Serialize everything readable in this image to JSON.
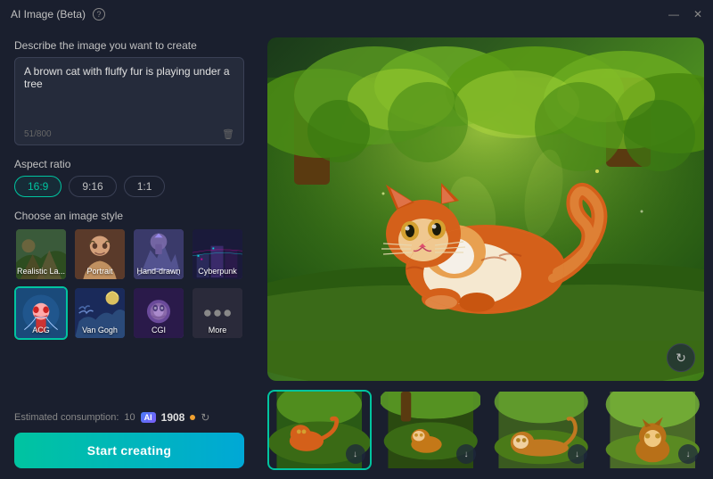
{
  "titleBar": {
    "title": "AI Image (Beta)",
    "infoBtn": "?",
    "minimizeBtn": "—",
    "closeBtn": "✕"
  },
  "leftPanel": {
    "promptLabel": "Describe the image you want to create",
    "promptValue": "A brown cat with fluffy fur is playing under a tree",
    "charCount": "51/800",
    "aspectLabel": "Aspect ratio",
    "aspectOptions": [
      {
        "id": "16-9",
        "label": "16:9",
        "active": true
      },
      {
        "id": "9-16",
        "label": "9:16",
        "active": false
      },
      {
        "id": "1-1",
        "label": "1:1",
        "active": false
      }
    ],
    "styleLabel": "Choose an image style",
    "styles": [
      {
        "id": "realistic",
        "label": "Realistic La...",
        "active": false,
        "emoji": "🏔"
      },
      {
        "id": "portrait",
        "label": "Portrait",
        "active": false,
        "emoji": "👤"
      },
      {
        "id": "handdrawn",
        "label": "Hand-drawn",
        "active": false,
        "emoji": "🏰"
      },
      {
        "id": "cyberpunk",
        "label": "Cyberpunk",
        "active": false,
        "emoji": "🌆"
      },
      {
        "id": "acg",
        "label": "ACG",
        "active": true,
        "emoji": "🎨"
      },
      {
        "id": "vangogh",
        "label": "Van Gogh",
        "active": false,
        "emoji": "🌀"
      },
      {
        "id": "cgi",
        "label": "CGI",
        "active": false,
        "emoji": "💫"
      },
      {
        "id": "more",
        "label": "More",
        "active": false,
        "emoji": "•••"
      }
    ],
    "estimatedConsumptionLabel": "Estimated consumption:",
    "consumptionValue": "10",
    "coinsValue": "1908",
    "startBtnLabel": "Start creating"
  },
  "thumbnails": [
    {
      "id": "thumb1",
      "active": true
    },
    {
      "id": "thumb2",
      "active": false
    },
    {
      "id": "thumb3",
      "active": false
    },
    {
      "id": "thumb4",
      "active": false
    }
  ],
  "icons": {
    "info": "ℹ",
    "minimize": "—",
    "close": "✕",
    "trash": "🗑",
    "refresh": "↻",
    "download": "⬇",
    "downloadSmall": "↓"
  }
}
